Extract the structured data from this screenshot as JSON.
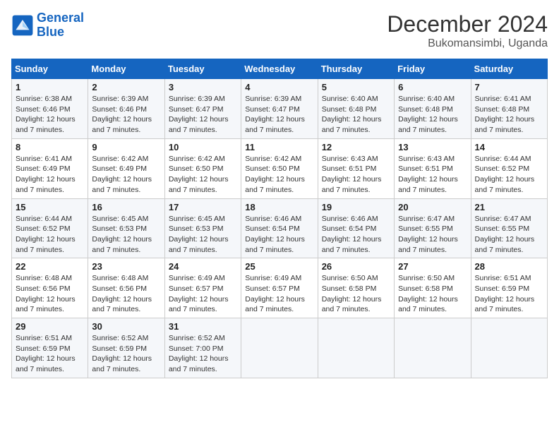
{
  "header": {
    "logo_line1": "General",
    "logo_line2": "Blue",
    "title": "December 2024",
    "subtitle": "Bukomansimbi, Uganda"
  },
  "weekdays": [
    "Sunday",
    "Monday",
    "Tuesday",
    "Wednesday",
    "Thursday",
    "Friday",
    "Saturday"
  ],
  "weeks": [
    [
      {
        "day": "1",
        "sunrise": "6:38 AM",
        "sunset": "6:46 PM",
        "daylight": "12 hours and 7 minutes."
      },
      {
        "day": "2",
        "sunrise": "6:39 AM",
        "sunset": "6:46 PM",
        "daylight": "12 hours and 7 minutes."
      },
      {
        "day": "3",
        "sunrise": "6:39 AM",
        "sunset": "6:47 PM",
        "daylight": "12 hours and 7 minutes."
      },
      {
        "day": "4",
        "sunrise": "6:39 AM",
        "sunset": "6:47 PM",
        "daylight": "12 hours and 7 minutes."
      },
      {
        "day": "5",
        "sunrise": "6:40 AM",
        "sunset": "6:48 PM",
        "daylight": "12 hours and 7 minutes."
      },
      {
        "day": "6",
        "sunrise": "6:40 AM",
        "sunset": "6:48 PM",
        "daylight": "12 hours and 7 minutes."
      },
      {
        "day": "7",
        "sunrise": "6:41 AM",
        "sunset": "6:48 PM",
        "daylight": "12 hours and 7 minutes."
      }
    ],
    [
      {
        "day": "8",
        "sunrise": "6:41 AM",
        "sunset": "6:49 PM",
        "daylight": "12 hours and 7 minutes."
      },
      {
        "day": "9",
        "sunrise": "6:42 AM",
        "sunset": "6:49 PM",
        "daylight": "12 hours and 7 minutes."
      },
      {
        "day": "10",
        "sunrise": "6:42 AM",
        "sunset": "6:50 PM",
        "daylight": "12 hours and 7 minutes."
      },
      {
        "day": "11",
        "sunrise": "6:42 AM",
        "sunset": "6:50 PM",
        "daylight": "12 hours and 7 minutes."
      },
      {
        "day": "12",
        "sunrise": "6:43 AM",
        "sunset": "6:51 PM",
        "daylight": "12 hours and 7 minutes."
      },
      {
        "day": "13",
        "sunrise": "6:43 AM",
        "sunset": "6:51 PM",
        "daylight": "12 hours and 7 minutes."
      },
      {
        "day": "14",
        "sunrise": "6:44 AM",
        "sunset": "6:52 PM",
        "daylight": "12 hours and 7 minutes."
      }
    ],
    [
      {
        "day": "15",
        "sunrise": "6:44 AM",
        "sunset": "6:52 PM",
        "daylight": "12 hours and 7 minutes."
      },
      {
        "day": "16",
        "sunrise": "6:45 AM",
        "sunset": "6:53 PM",
        "daylight": "12 hours and 7 minutes."
      },
      {
        "day": "17",
        "sunrise": "6:45 AM",
        "sunset": "6:53 PM",
        "daylight": "12 hours and 7 minutes."
      },
      {
        "day": "18",
        "sunrise": "6:46 AM",
        "sunset": "6:54 PM",
        "daylight": "12 hours and 7 minutes."
      },
      {
        "day": "19",
        "sunrise": "6:46 AM",
        "sunset": "6:54 PM",
        "daylight": "12 hours and 7 minutes."
      },
      {
        "day": "20",
        "sunrise": "6:47 AM",
        "sunset": "6:55 PM",
        "daylight": "12 hours and 7 minutes."
      },
      {
        "day": "21",
        "sunrise": "6:47 AM",
        "sunset": "6:55 PM",
        "daylight": "12 hours and 7 minutes."
      }
    ],
    [
      {
        "day": "22",
        "sunrise": "6:48 AM",
        "sunset": "6:56 PM",
        "daylight": "12 hours and 7 minutes."
      },
      {
        "day": "23",
        "sunrise": "6:48 AM",
        "sunset": "6:56 PM",
        "daylight": "12 hours and 7 minutes."
      },
      {
        "day": "24",
        "sunrise": "6:49 AM",
        "sunset": "6:57 PM",
        "daylight": "12 hours and 7 minutes."
      },
      {
        "day": "25",
        "sunrise": "6:49 AM",
        "sunset": "6:57 PM",
        "daylight": "12 hours and 7 minutes."
      },
      {
        "day": "26",
        "sunrise": "6:50 AM",
        "sunset": "6:58 PM",
        "daylight": "12 hours and 7 minutes."
      },
      {
        "day": "27",
        "sunrise": "6:50 AM",
        "sunset": "6:58 PM",
        "daylight": "12 hours and 7 minutes."
      },
      {
        "day": "28",
        "sunrise": "6:51 AM",
        "sunset": "6:59 PM",
        "daylight": "12 hours and 7 minutes."
      }
    ],
    [
      {
        "day": "29",
        "sunrise": "6:51 AM",
        "sunset": "6:59 PM",
        "daylight": "12 hours and 7 minutes."
      },
      {
        "day": "30",
        "sunrise": "6:52 AM",
        "sunset": "6:59 PM",
        "daylight": "12 hours and 7 minutes."
      },
      {
        "day": "31",
        "sunrise": "6:52 AM",
        "sunset": "7:00 PM",
        "daylight": "12 hours and 7 minutes."
      },
      null,
      null,
      null,
      null
    ]
  ]
}
